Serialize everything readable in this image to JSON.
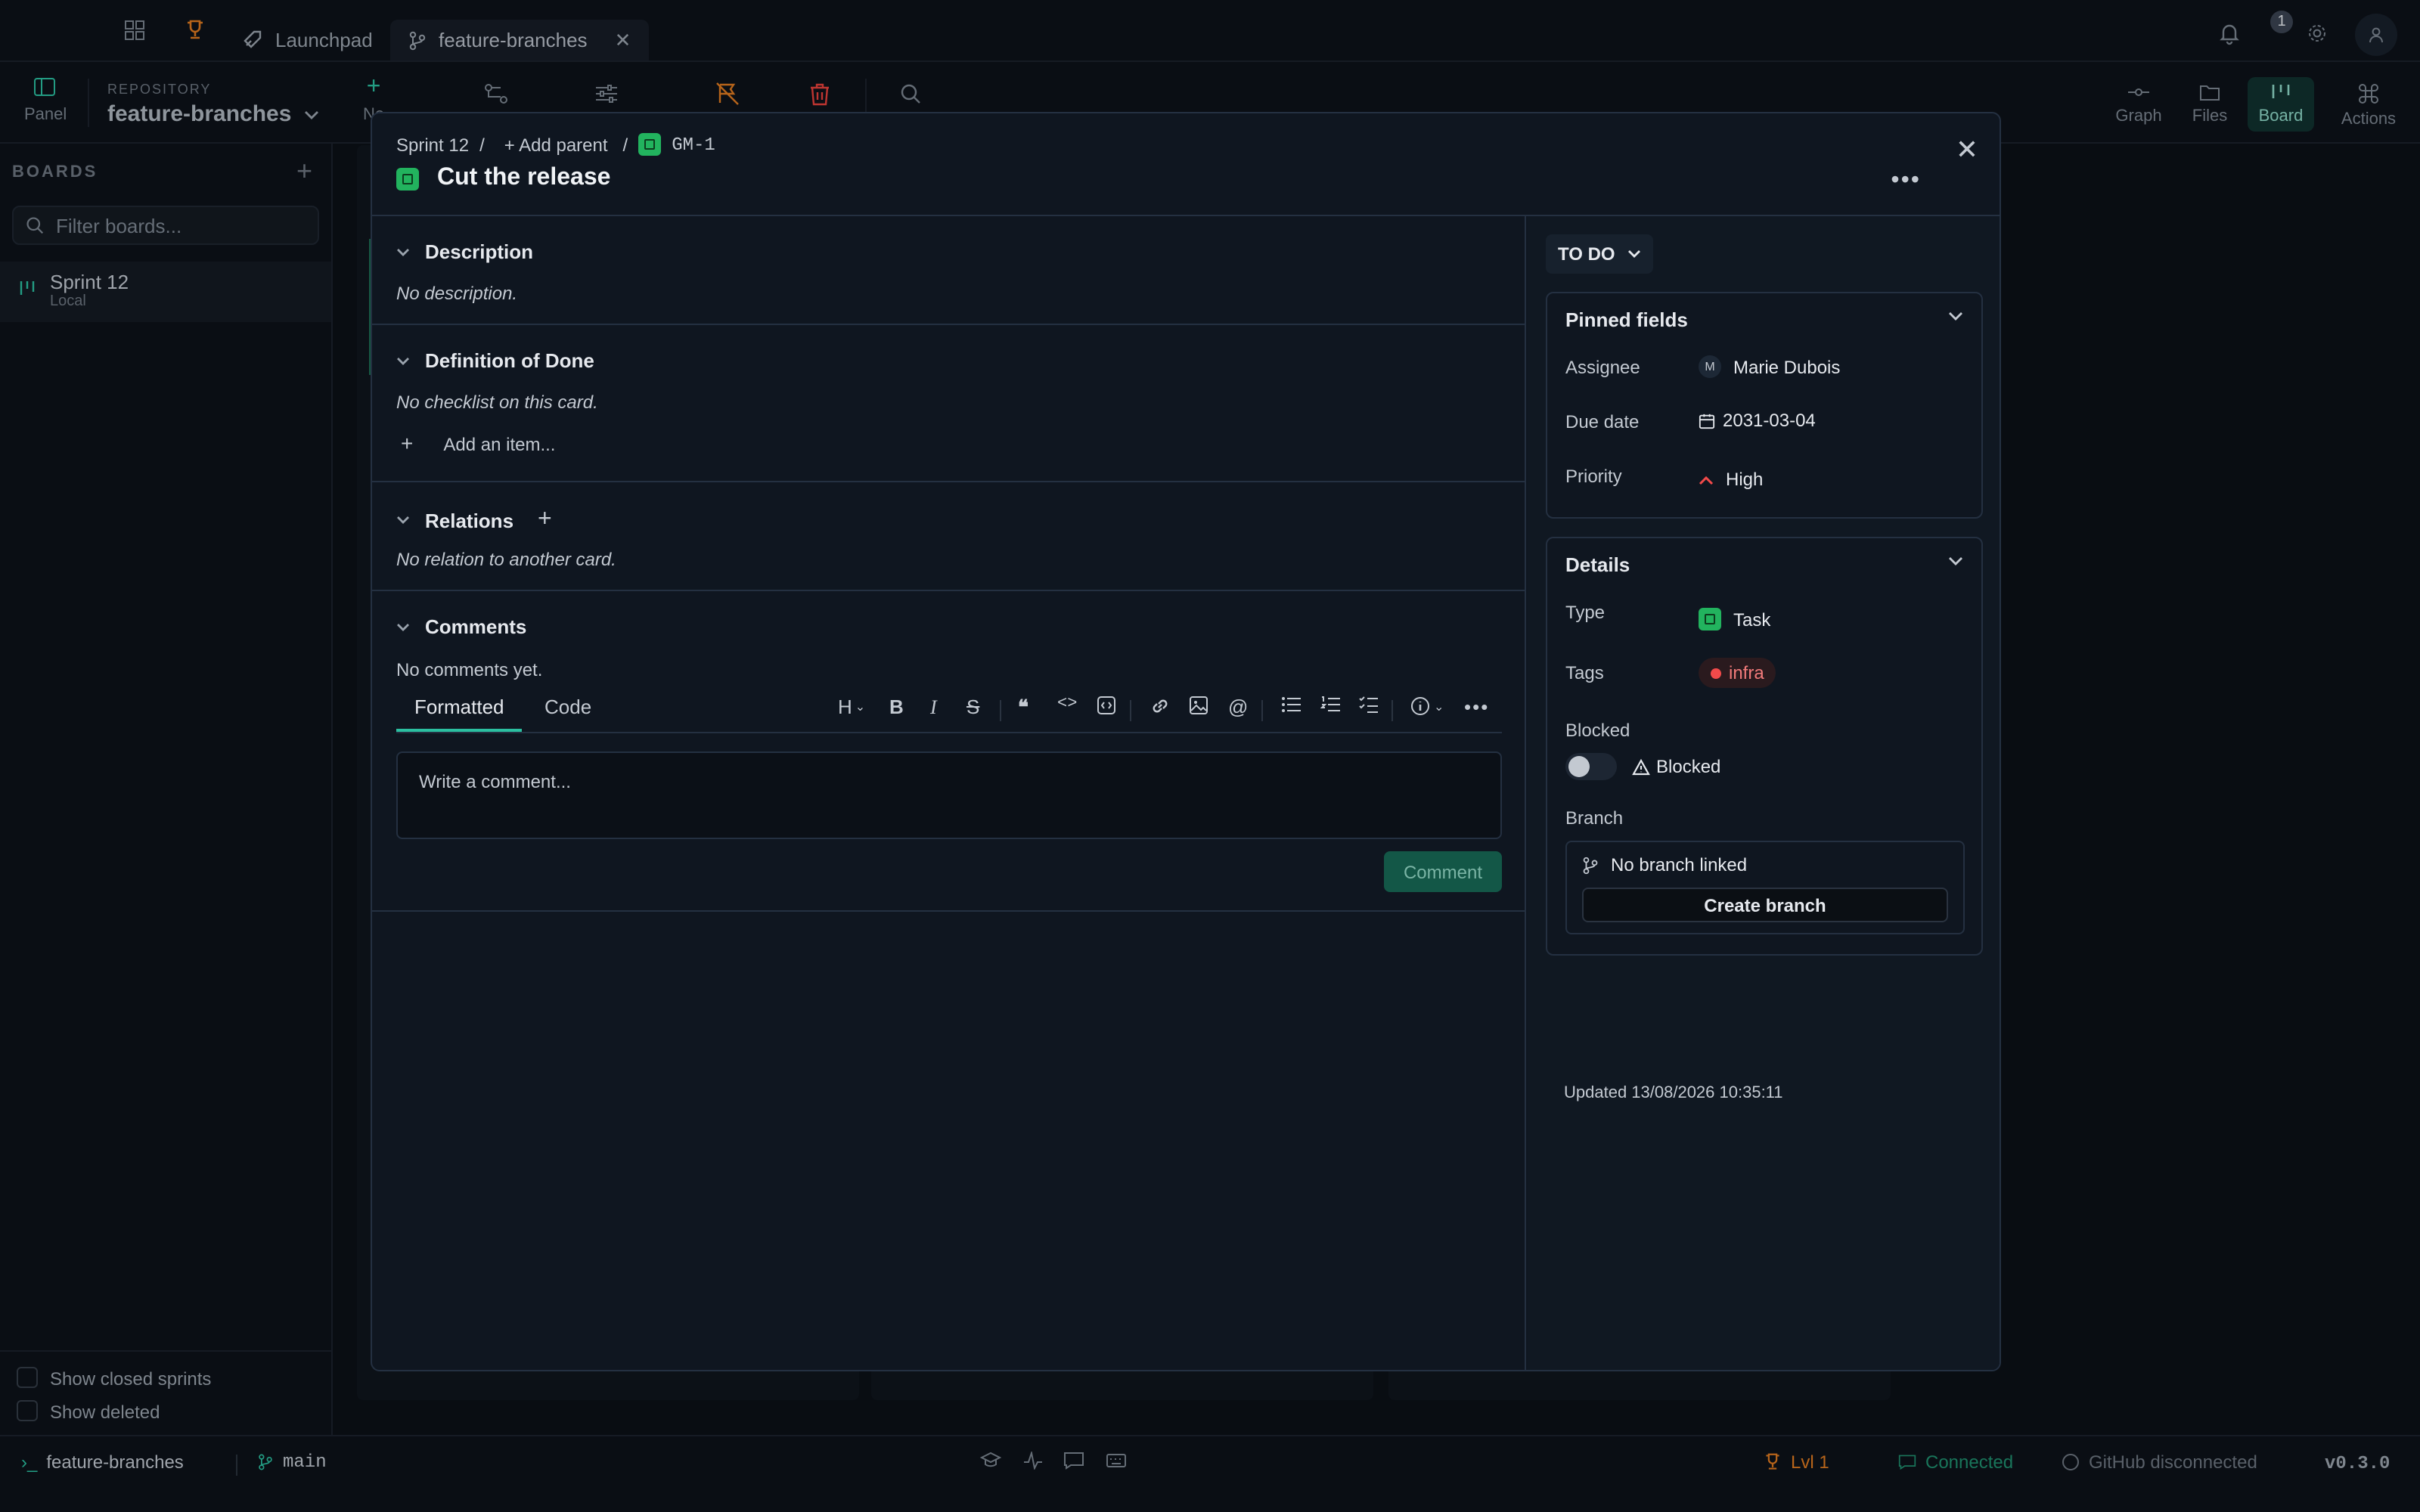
{
  "topbar": {
    "tabs": [
      {
        "label": "Launchpad"
      },
      {
        "label": "feature-branches"
      }
    ],
    "notification_count": "1"
  },
  "toolbar": {
    "panel_label": "Panel",
    "repo_label": "REPOSITORY",
    "repo_name": "feature-branches",
    "new_label": "Ne",
    "right": [
      {
        "label": "Graph"
      },
      {
        "label": "Files"
      },
      {
        "label": "Board"
      },
      {
        "label": "Actions"
      }
    ]
  },
  "sidebar": {
    "header": "BOARDS",
    "filter_placeholder": "Filter boards...",
    "sprint": {
      "name": "Sprint 12",
      "sub": "Local"
    },
    "show_closed": "Show closed sprints",
    "show_deleted": "Show deleted"
  },
  "statusbar": {
    "repo": "feature-branches",
    "branch": "main",
    "level": "Lvl 1",
    "connected": "Connected",
    "github": "GitHub disconnected",
    "version": "v0.3.0"
  },
  "modal": {
    "breadcrumb": {
      "sprint": "Sprint 12",
      "sep": "/",
      "add_parent": "+ Add parent",
      "id": "GM-1"
    },
    "title": "Cut the release",
    "sections": {
      "description": {
        "title": "Description",
        "text": "No description."
      },
      "dod": {
        "title": "Definition of Done",
        "text": "No checklist on this card.",
        "add": "Add an item..."
      },
      "relations": {
        "title": "Relations",
        "text": "No relation to another card."
      },
      "comments": {
        "title": "Comments",
        "text": "No comments yet."
      }
    },
    "editor": {
      "tab_formatted": "Formatted",
      "tab_code": "Code",
      "placeholder": "Write a comment...",
      "submit": "Comment"
    },
    "status": "TO DO",
    "pinned": {
      "title": "Pinned fields",
      "assignee_label": "Assignee",
      "assignee_initial": "M",
      "assignee": "Marie Dubois",
      "due_label": "Due date",
      "due": "2031-03-04",
      "priority_label": "Priority",
      "priority": "High"
    },
    "details": {
      "title": "Details",
      "type_label": "Type",
      "type": "Task",
      "tags_label": "Tags",
      "tag": "infra",
      "blocked_label": "Blocked",
      "blocked_toggle": "Blocked",
      "branch_label": "Branch",
      "no_branch": "No branch linked",
      "create_branch": "Create branch"
    },
    "updated": "Updated 13/08/2026 10:35:11"
  },
  "colors": {
    "accent": "#2bbfa0",
    "task_green": "#22b35e",
    "priority_red": "#f14a4a",
    "background": "#0b1017"
  }
}
